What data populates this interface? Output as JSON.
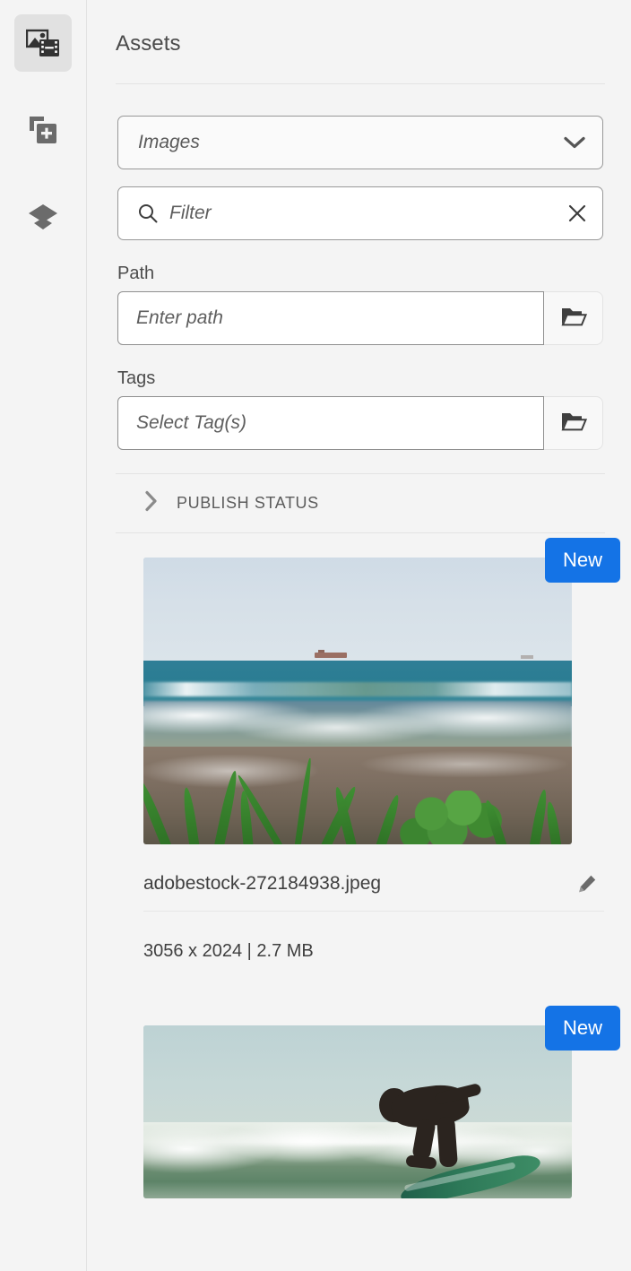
{
  "window": {
    "background": "#f4f4f4",
    "accent_blue": "#1473e6"
  },
  "rail": {
    "items": [
      {
        "name": "media-assets",
        "icon": "image-video-icon",
        "selected": true
      },
      {
        "name": "add-content",
        "icon": "copy-add-icon",
        "selected": false
      },
      {
        "name": "layers",
        "icon": "layers-icon",
        "selected": false
      }
    ]
  },
  "header": {
    "title": "Assets"
  },
  "asset_type_select": {
    "name": "asset-type-select",
    "value": "Images",
    "icon": "chevron-down-icon",
    "options": [
      "Images"
    ]
  },
  "filter": {
    "name": "filter-input",
    "placeholder": "Filter",
    "value": "",
    "search_icon": "search-icon",
    "clear_icon": "close-icon"
  },
  "path_field": {
    "label": "Path",
    "placeholder": "Enter path",
    "value": "",
    "browse_icon": "folder-icon"
  },
  "tags_field": {
    "label": "Tags",
    "placeholder": "Select Tag(s)",
    "value": "",
    "browse_icon": "folder-icon"
  },
  "publish_status": {
    "label": "PUBLISH STATUS",
    "expanded": false,
    "icon": "chevron-right-icon"
  },
  "assets": [
    {
      "badge": "New",
      "filename": "adobestock-272184938.jpeg",
      "meta": "3056 x 2024 | 2.7 MB",
      "edit_icon": "pencil-icon",
      "thumbnail_alt": "beach-ocean-scene"
    },
    {
      "badge": "New",
      "filename": "",
      "meta": "",
      "edit_icon": "pencil-icon",
      "thumbnail_alt": "surfer-riding-wave"
    }
  ]
}
